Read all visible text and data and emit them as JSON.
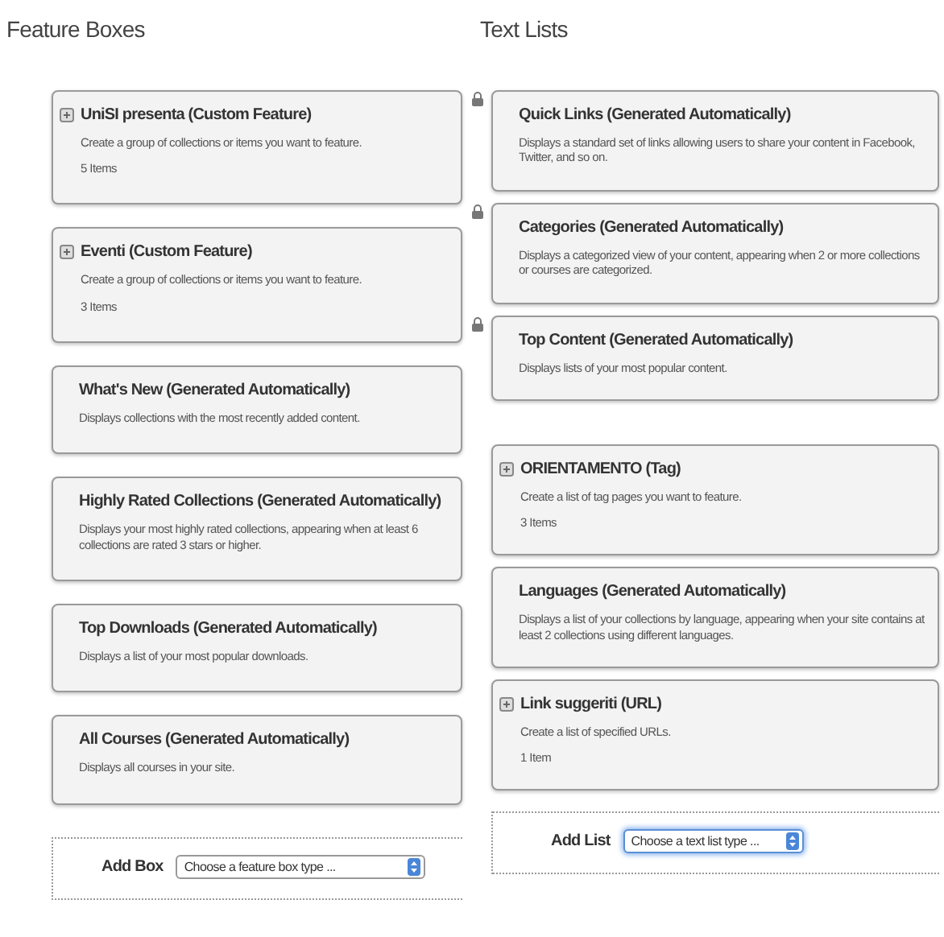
{
  "columns": [
    {
      "heading": "Feature Boxes",
      "boxes": [
        {
          "kind": "custom",
          "title": "UniSI presenta (Custom Feature)",
          "description": "Create a group of collections or items you want to feature.",
          "count": "5 Items"
        },
        {
          "kind": "custom",
          "title": "Eventi (Custom Feature)",
          "description": "Create a group of collections or items you want to feature.",
          "count": "3 Items"
        },
        {
          "kind": "generated",
          "title": "What's New (Generated Automatically)",
          "description": "Displays collections with the most recently added content."
        },
        {
          "kind": "generated",
          "title": "Highly Rated Collections (Generated Automatically)",
          "description": "Displays your most highly rated collections, appearing when at least 6 collections are rated 3 stars or higher."
        },
        {
          "kind": "generated",
          "title": "Top Downloads (Generated Automatically)",
          "description": "Displays a list of your most popular downloads."
        },
        {
          "kind": "generated",
          "title": "All Courses (Generated Automatically)",
          "description": "Displays all courses in your site."
        }
      ],
      "add": {
        "label": "Add Box",
        "select": "Choose a feature box type ...",
        "focused": false
      }
    },
    {
      "heading": "Text Lists",
      "boxes": [
        {
          "kind": "generated",
          "locked": true,
          "title": "Quick Links (Generated Automatically)",
          "description": "Displays a standard set of links allowing users to share your content in Facebook, Twitter, and so on."
        },
        {
          "kind": "generated",
          "locked": true,
          "title": "Categories (Generated Automatically)",
          "description": "Displays a categorized view of your content, appearing when 2 or more collections or courses are categorized."
        },
        {
          "kind": "generated",
          "locked": true,
          "title": "Top Content (Generated Automatically)",
          "description": "Displays lists of your most popular content."
        },
        {
          "kind": "custom",
          "locked": false,
          "title": "ORIENTAMENTO (Tag)",
          "description": "Create a list of tag pages you want to feature.",
          "count": "3 Items"
        },
        {
          "kind": "generated",
          "locked": false,
          "title": "Languages (Generated Automatically)",
          "description": "Displays a list of your collections by language, appearing when your site contains at least 2 collections using different languages."
        },
        {
          "kind": "custom",
          "locked": false,
          "title": "Link suggeriti (URL)",
          "description": "Create a list of specified URLs.",
          "count": "1 Item"
        }
      ],
      "add": {
        "label": "Add List",
        "select": "Choose a text list type ...",
        "focused": true
      }
    }
  ]
}
